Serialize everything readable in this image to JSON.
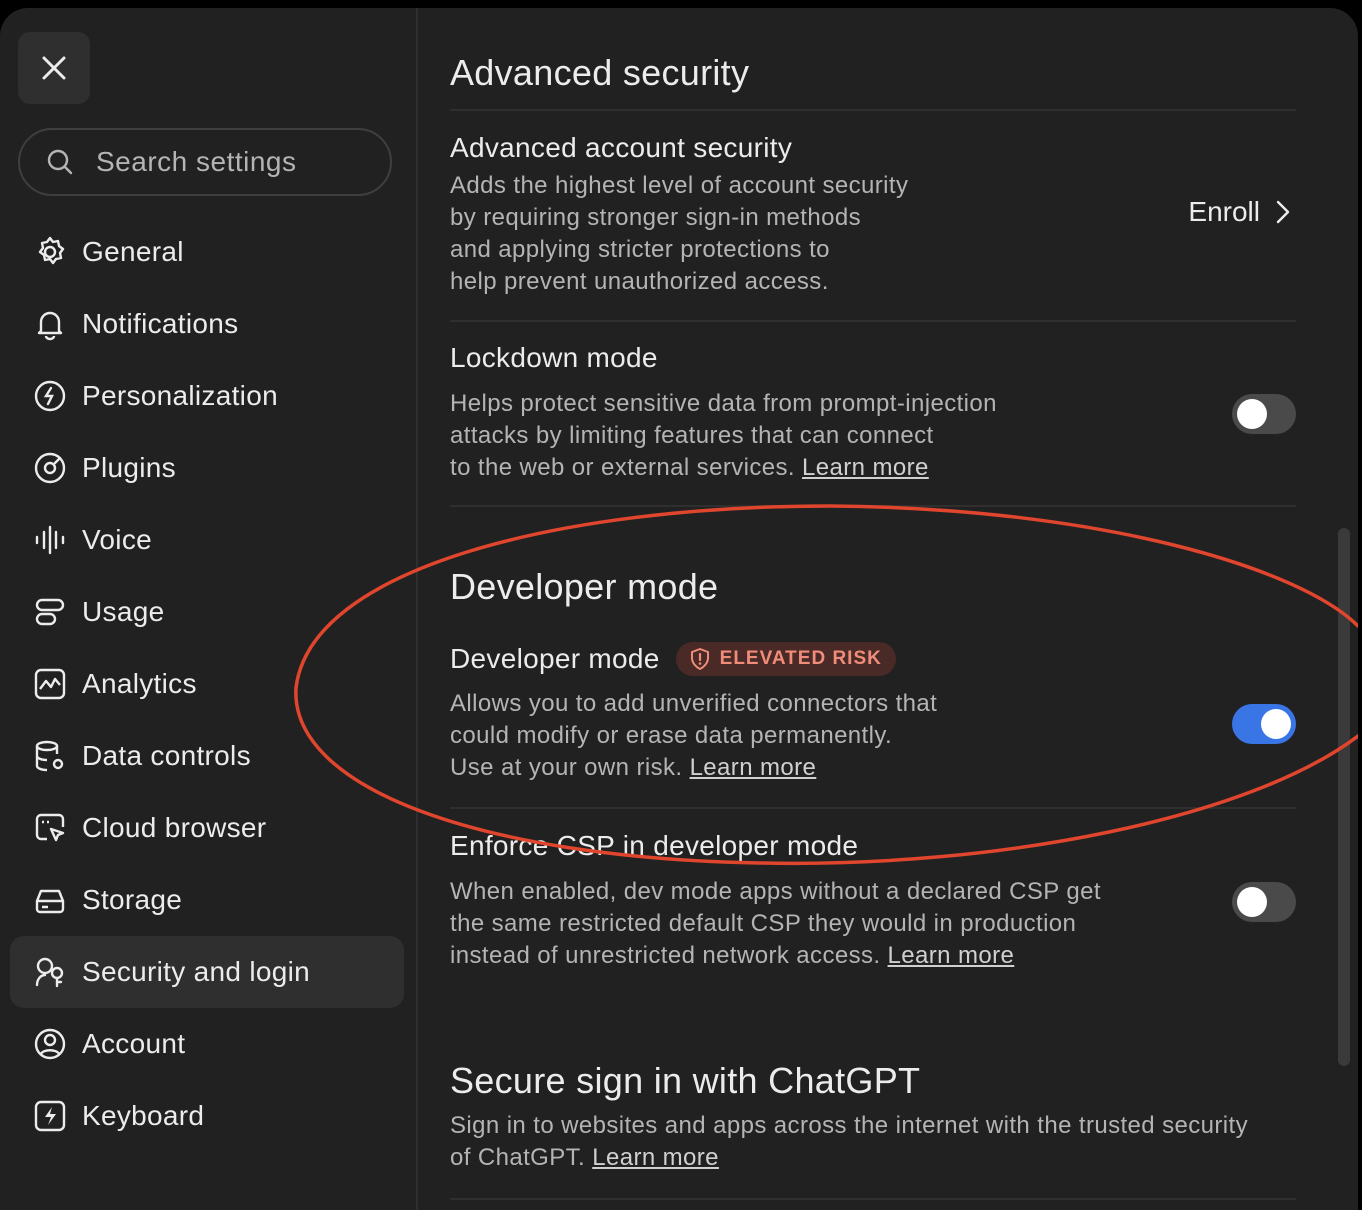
{
  "sidebar": {
    "close_label": "Close",
    "search": {
      "placeholder": "Search settings",
      "value": ""
    },
    "items": [
      {
        "label": "General",
        "icon": "gear-icon",
        "active": false
      },
      {
        "label": "Notifications",
        "icon": "bell-icon",
        "active": false
      },
      {
        "label": "Personalization",
        "icon": "personalization-icon",
        "active": false
      },
      {
        "label": "Plugins",
        "icon": "plugins-icon",
        "active": false
      },
      {
        "label": "Voice",
        "icon": "waveform-icon",
        "active": false
      },
      {
        "label": "Usage",
        "icon": "usage-icon",
        "active": false
      },
      {
        "label": "Analytics",
        "icon": "analytics-icon",
        "active": false
      },
      {
        "label": "Data controls",
        "icon": "database-icon",
        "active": false
      },
      {
        "label": "Cloud browser",
        "icon": "cloud-browser-icon",
        "active": false
      },
      {
        "label": "Storage",
        "icon": "storage-icon",
        "active": false
      },
      {
        "label": "Security and login",
        "icon": "security-icon",
        "active": true
      },
      {
        "label": "Account",
        "icon": "account-icon",
        "active": false
      },
      {
        "label": "Keyboard",
        "icon": "keyboard-icon",
        "active": false
      }
    ]
  },
  "main": {
    "advanced": {
      "title": "Advanced security",
      "account_security": {
        "title": "Advanced account security",
        "desc_lines": [
          "Adds the highest level of account security",
          "by requiring stronger sign-in methods",
          "and applying stricter protections to",
          "help prevent unauthorized access."
        ],
        "action": "Enroll"
      },
      "lockdown": {
        "title": "Lockdown mode",
        "desc_lines": [
          "Helps protect sensitive data from prompt-injection",
          "attacks by limiting features that can connect",
          "to the web or external services."
        ],
        "learn_more": "Learn more",
        "enabled": false
      }
    },
    "developer": {
      "title": "Developer mode",
      "developer_mode": {
        "title": "Developer mode",
        "badge": "ELEVATED RISK",
        "desc_lines": [
          "Allows you to add unverified connectors that",
          "could modify or erase data permanently.",
          "Use at your own risk."
        ],
        "learn_more": "Learn more",
        "enabled": true
      },
      "enforce_csp": {
        "title": "Enforce CSP in developer mode",
        "desc_lines": [
          "When enabled, dev mode apps without a declared CSP get",
          "the same restricted default CSP they would in production",
          "instead of unrestricted network access."
        ],
        "learn_more": "Learn more",
        "enabled": false
      }
    },
    "secure_sign_in": {
      "title": "Secure sign in with ChatGPT",
      "desc_lines": [
        "Sign in to websites and apps across the internet with the trusted security",
        "of ChatGPT."
      ],
      "learn_more": "Learn more"
    }
  },
  "colors": {
    "background": "#212121",
    "toggle_on": "#3a75e6",
    "badge_text": "#f08c7a",
    "annotation": "#e0452e"
  }
}
